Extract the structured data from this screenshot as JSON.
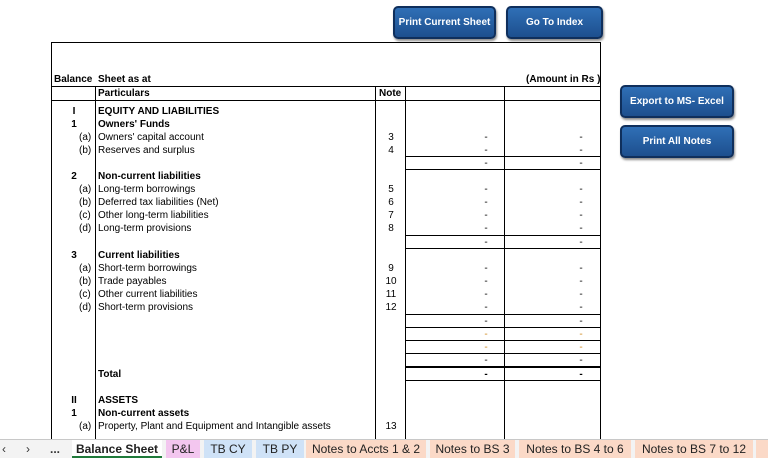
{
  "buttons": {
    "print_current": "Print Current Sheet",
    "go_index": "Go To Index",
    "export_excel": "Export to MS- Excel",
    "print_notes": "Print All Notes"
  },
  "sheet": {
    "title_left": "Balance",
    "title_right": "Sheet as at",
    "amount_label": "(Amount in Rs )",
    "col_particulars": "Particulars",
    "col_note": "Note",
    "dash": "-",
    "rows": [
      {
        "num": "I",
        "text": "EQUITY AND LIABILITIES",
        "note": ""
      },
      {
        "num": "1",
        "text": "Owners' Funds",
        "note": ""
      },
      {
        "num": "(a)",
        "text": "Owners' capital account",
        "note": "3"
      },
      {
        "num": "(b)",
        "text": "Reserves and surplus",
        "note": "4"
      },
      {
        "num": "2",
        "text": "Non-current liabilities",
        "note": ""
      },
      {
        "num": "(a)",
        "text": "Long-term borrowings",
        "note": "5"
      },
      {
        "num": "(b)",
        "text": "Deferred tax liabilities (Net)",
        "note": "6"
      },
      {
        "num": "(c)",
        "text": "Other long-term liabilities",
        "note": "7"
      },
      {
        "num": "(d)",
        "text": "Long-term provisions",
        "note": "8"
      },
      {
        "num": "3",
        "text": "Current liabilities",
        "note": ""
      },
      {
        "num": "(a)",
        "text": "Short-term borrowings",
        "note": "9"
      },
      {
        "num": "(b)",
        "text": "Trade payables",
        "note": "10"
      },
      {
        "num": "(c)",
        "text": "Other current liabilities",
        "note": "11"
      },
      {
        "num": "(d)",
        "text": "Short-term provisions",
        "note": "12"
      },
      {
        "num": "",
        "text": "Total",
        "note": ""
      },
      {
        "num": "II",
        "text": "ASSETS",
        "note": ""
      },
      {
        "num": "1",
        "text": "Non-current assets",
        "note": ""
      },
      {
        "num": "(a)",
        "text": "Property, Plant and Equipment and Intangible assets",
        "note": "13"
      }
    ]
  },
  "colors": {
    "orange_dash": "#d08a1e",
    "tab_pl": "#f3c6ef",
    "tab_tb": "#cfe2f7",
    "tab_notes": "#fbd9c7"
  },
  "tabs": {
    "more": "...",
    "balance_sheet": "Balance Sheet",
    "pl": "P&L",
    "tb_cy": "TB CY",
    "tb_py": "TB PY",
    "notes_1_2": "Notes to Accts 1 & 2",
    "notes_bs3": "Notes to BS 3",
    "notes_bs4_6": "Notes to BS 4 to 6",
    "notes_bs7_12": "Notes to BS 7 to 12"
  }
}
